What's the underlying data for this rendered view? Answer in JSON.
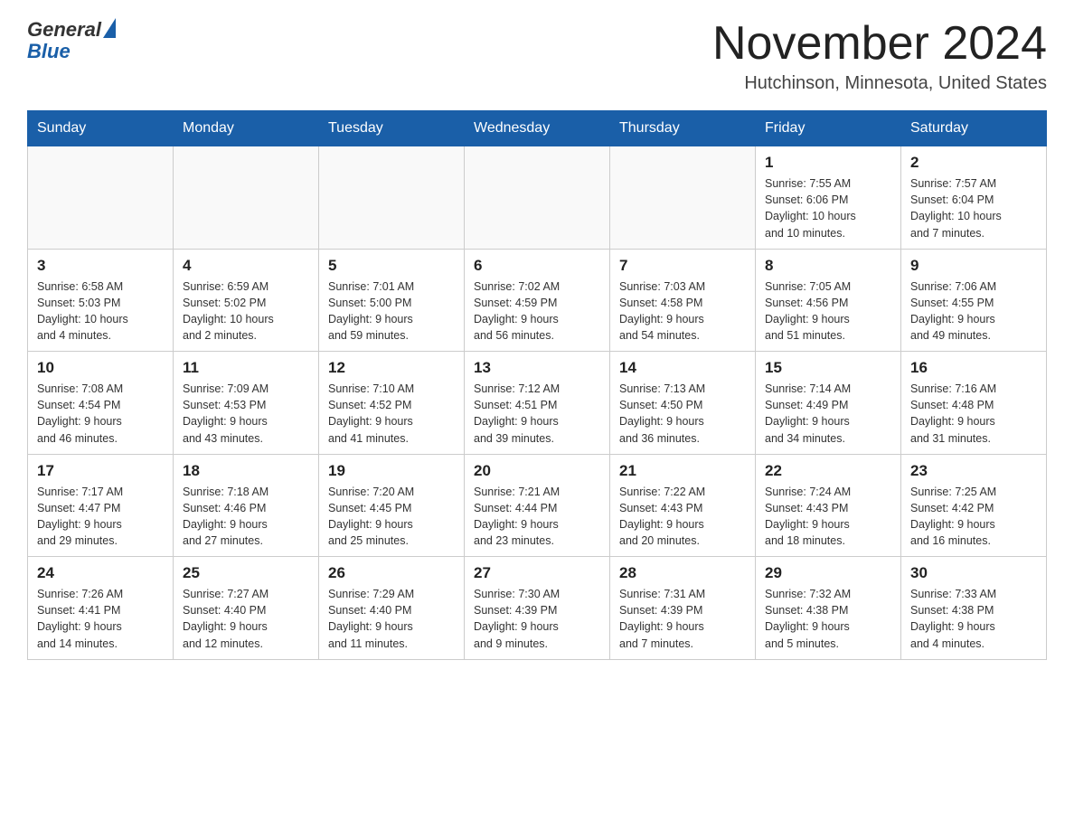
{
  "header": {
    "logo_general": "General",
    "logo_blue": "Blue",
    "title": "November 2024",
    "subtitle": "Hutchinson, Minnesota, United States"
  },
  "days_of_week": [
    "Sunday",
    "Monday",
    "Tuesday",
    "Wednesday",
    "Thursday",
    "Friday",
    "Saturday"
  ],
  "weeks": [
    [
      {
        "day": "",
        "info": ""
      },
      {
        "day": "",
        "info": ""
      },
      {
        "day": "",
        "info": ""
      },
      {
        "day": "",
        "info": ""
      },
      {
        "day": "",
        "info": ""
      },
      {
        "day": "1",
        "info": "Sunrise: 7:55 AM\nSunset: 6:06 PM\nDaylight: 10 hours\nand 10 minutes."
      },
      {
        "day": "2",
        "info": "Sunrise: 7:57 AM\nSunset: 6:04 PM\nDaylight: 10 hours\nand 7 minutes."
      }
    ],
    [
      {
        "day": "3",
        "info": "Sunrise: 6:58 AM\nSunset: 5:03 PM\nDaylight: 10 hours\nand 4 minutes."
      },
      {
        "day": "4",
        "info": "Sunrise: 6:59 AM\nSunset: 5:02 PM\nDaylight: 10 hours\nand 2 minutes."
      },
      {
        "day": "5",
        "info": "Sunrise: 7:01 AM\nSunset: 5:00 PM\nDaylight: 9 hours\nand 59 minutes."
      },
      {
        "day": "6",
        "info": "Sunrise: 7:02 AM\nSunset: 4:59 PM\nDaylight: 9 hours\nand 56 minutes."
      },
      {
        "day": "7",
        "info": "Sunrise: 7:03 AM\nSunset: 4:58 PM\nDaylight: 9 hours\nand 54 minutes."
      },
      {
        "day": "8",
        "info": "Sunrise: 7:05 AM\nSunset: 4:56 PM\nDaylight: 9 hours\nand 51 minutes."
      },
      {
        "day": "9",
        "info": "Sunrise: 7:06 AM\nSunset: 4:55 PM\nDaylight: 9 hours\nand 49 minutes."
      }
    ],
    [
      {
        "day": "10",
        "info": "Sunrise: 7:08 AM\nSunset: 4:54 PM\nDaylight: 9 hours\nand 46 minutes."
      },
      {
        "day": "11",
        "info": "Sunrise: 7:09 AM\nSunset: 4:53 PM\nDaylight: 9 hours\nand 43 minutes."
      },
      {
        "day": "12",
        "info": "Sunrise: 7:10 AM\nSunset: 4:52 PM\nDaylight: 9 hours\nand 41 minutes."
      },
      {
        "day": "13",
        "info": "Sunrise: 7:12 AM\nSunset: 4:51 PM\nDaylight: 9 hours\nand 39 minutes."
      },
      {
        "day": "14",
        "info": "Sunrise: 7:13 AM\nSunset: 4:50 PM\nDaylight: 9 hours\nand 36 minutes."
      },
      {
        "day": "15",
        "info": "Sunrise: 7:14 AM\nSunset: 4:49 PM\nDaylight: 9 hours\nand 34 minutes."
      },
      {
        "day": "16",
        "info": "Sunrise: 7:16 AM\nSunset: 4:48 PM\nDaylight: 9 hours\nand 31 minutes."
      }
    ],
    [
      {
        "day": "17",
        "info": "Sunrise: 7:17 AM\nSunset: 4:47 PM\nDaylight: 9 hours\nand 29 minutes."
      },
      {
        "day": "18",
        "info": "Sunrise: 7:18 AM\nSunset: 4:46 PM\nDaylight: 9 hours\nand 27 minutes."
      },
      {
        "day": "19",
        "info": "Sunrise: 7:20 AM\nSunset: 4:45 PM\nDaylight: 9 hours\nand 25 minutes."
      },
      {
        "day": "20",
        "info": "Sunrise: 7:21 AM\nSunset: 4:44 PM\nDaylight: 9 hours\nand 23 minutes."
      },
      {
        "day": "21",
        "info": "Sunrise: 7:22 AM\nSunset: 4:43 PM\nDaylight: 9 hours\nand 20 minutes."
      },
      {
        "day": "22",
        "info": "Sunrise: 7:24 AM\nSunset: 4:43 PM\nDaylight: 9 hours\nand 18 minutes."
      },
      {
        "day": "23",
        "info": "Sunrise: 7:25 AM\nSunset: 4:42 PM\nDaylight: 9 hours\nand 16 minutes."
      }
    ],
    [
      {
        "day": "24",
        "info": "Sunrise: 7:26 AM\nSunset: 4:41 PM\nDaylight: 9 hours\nand 14 minutes."
      },
      {
        "day": "25",
        "info": "Sunrise: 7:27 AM\nSunset: 4:40 PM\nDaylight: 9 hours\nand 12 minutes."
      },
      {
        "day": "26",
        "info": "Sunrise: 7:29 AM\nSunset: 4:40 PM\nDaylight: 9 hours\nand 11 minutes."
      },
      {
        "day": "27",
        "info": "Sunrise: 7:30 AM\nSunset: 4:39 PM\nDaylight: 9 hours\nand 9 minutes."
      },
      {
        "day": "28",
        "info": "Sunrise: 7:31 AM\nSunset: 4:39 PM\nDaylight: 9 hours\nand 7 minutes."
      },
      {
        "day": "29",
        "info": "Sunrise: 7:32 AM\nSunset: 4:38 PM\nDaylight: 9 hours\nand 5 minutes."
      },
      {
        "day": "30",
        "info": "Sunrise: 7:33 AM\nSunset: 4:38 PM\nDaylight: 9 hours\nand 4 minutes."
      }
    ]
  ]
}
